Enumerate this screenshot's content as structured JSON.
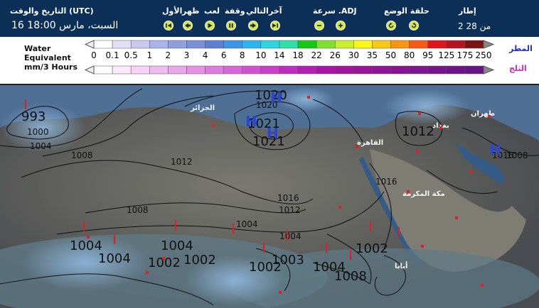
{
  "header": {
    "datetime_label": "التاريخ والوقت (UTC)",
    "datetime_value": "السبت، مارس 18:00 16",
    "frame_label": "إطار",
    "frame_value": "من 28 2",
    "speed_label": "سرعة .ADJ",
    "loop_label": "حلقة الوضع",
    "control_labels": [
      "آخر",
      "التالي",
      "وقفة",
      "لعب",
      "ظهر",
      "الأول"
    ]
  },
  "legend": {
    "title_line1": "Water",
    "title_line2": "Equivalent",
    "title_line3": "mm/3 Hours",
    "rain_label": "المطر",
    "snow_label": "الثلج",
    "scale_values": [
      "0",
      "0.1",
      "0.5",
      "1",
      "2",
      "3",
      "4",
      "6",
      "8",
      "10",
      "14",
      "18",
      "22",
      "26",
      "30",
      "35",
      "50",
      "80",
      "95",
      "125",
      "175",
      "250"
    ],
    "rain_colors": [
      "#ffffff",
      "#e0e0f8",
      "#c9c9f0",
      "#aab3ea",
      "#8fa0e0",
      "#7b8ed8",
      "#5d7fd0",
      "#3d95e6",
      "#2cb4f0",
      "#2cd6e0",
      "#2ce0a8",
      "#14c814",
      "#7ee02c",
      "#c8f02c",
      "#f8f814",
      "#f8c814",
      "#f89614",
      "#f85a14",
      "#e0141e",
      "#b4141e",
      "#7a1414"
    ],
    "snow_colors": [
      "#ffffff",
      "#fbe8fb",
      "#f6d2f6",
      "#f0bcf0",
      "#eaa6ea",
      "#e491e4",
      "#de7bde",
      "#d866d8",
      "#d152d1",
      "#c93ec9",
      "#c02cc0",
      "#b41eb4",
      "#a814a8",
      "#a014a0",
      "#98149c",
      "#901498",
      "#881494",
      "#7e1490",
      "#76148c",
      "#6e1488",
      "#661484"
    ]
  },
  "map": {
    "cities": [
      "الجزائر",
      "طهران",
      "بغداد",
      "القاهرة",
      "مكة المكرمة",
      "أبابا"
    ],
    "isobars": [
      "993",
      "1000",
      "1004",
      "1008",
      "1012",
      "1016",
      "1020",
      "1021",
      "1021",
      "1012",
      "1008",
      "1004",
      "1004",
      "1004",
      "1004",
      "1004",
      "1002",
      "1002",
      "1002",
      "1003",
      "1002",
      "1004",
      "1008",
      "1016",
      "1012",
      "1008",
      "1016",
      "1020"
    ],
    "highs": [
      "H",
      "H",
      "H",
      "H"
    ]
  }
}
